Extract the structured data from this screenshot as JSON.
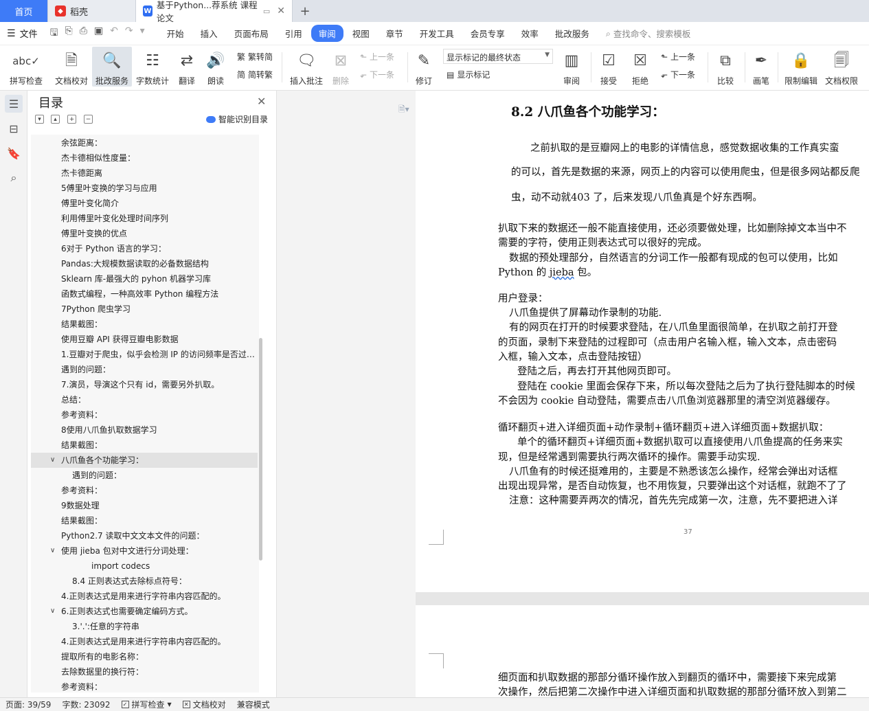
{
  "tabs": {
    "home": "首页",
    "daoke": "稻壳",
    "doc": "基于Python...荐系统 课程论文"
  },
  "menu": {
    "file": "文件",
    "tabs": [
      "开始",
      "插入",
      "页面布局",
      "引用",
      "审阅",
      "视图",
      "章节",
      "开发工具",
      "会员专享",
      "效率",
      "批改服务"
    ],
    "active_tab": "审阅",
    "search": "查找命令、搜索模板"
  },
  "ribbon": {
    "spell": "拼写检查",
    "proofread": "文档校对",
    "correction": "批改服务",
    "wordcount": "字数统计",
    "translate": "翻译",
    "read": "朗读",
    "trad": "繁转简",
    "simp": "简转繁",
    "insert_comment": "插入批注",
    "delete": "删除",
    "prev": "上一条",
    "next": "下一条",
    "revise": "修订",
    "markup_select": "显示标记的最终状态",
    "show_markup": "显示标记",
    "review": "审阅",
    "accept": "接受",
    "reject": "拒绝",
    "prev2": "上一条",
    "next2": "下一条",
    "compare": "比较",
    "pen": "画笔",
    "restrict": "限制编辑",
    "permission": "文档权限"
  },
  "toc": {
    "title": "目录",
    "ai_label": "智能识别目录",
    "items": [
      "余弦距离：",
      "杰卡德相似性度量：",
      "杰卡德距离",
      "5傅里叶变换的学习与应用",
      "傅里叶变化简介",
      "利用傅里叶变化处理时间序列",
      "傅里叶变换的优点",
      "6对于 Python 语言的学习：",
      "Pandas:大规模数据读取的必备数据结构",
      "Sklearn 库-最强大的 pyhon 机器学习库",
      "函数式编程，一种高效率 Python 编程方法",
      "7Python 爬虫学习",
      "结果截图：",
      "使用豆瓣 API 获得豆瓣电影数据",
      "1.豆瓣对于爬虫，似乎会检测 IP 的访问频率是否过于频繁",
      "遇到的问题：",
      "7.演员，导演这个只有 id，需要另外扒取。",
      "总结：",
      "参考资料：",
      "8使用八爪鱼扒取数据学习",
      "结果截图：",
      "八爪鱼各个功能学习：",
      "遇到的问题：",
      "参考资料：",
      "9数据处理",
      "结果截图：",
      "Python2.7 读取中文文本文件的问题：",
      "使用 jieba 包对中文进行分词处理：",
      "import codecs",
      "8.4 正则表达式去除标点符号：",
      "4.正则表达式是用来进行字符串内容匹配的。",
      "6.正则表达式也需要确定编码方式。",
      "3.'.':任意的字符串",
      "4.正则表达式是用来进行字符串内容匹配的。",
      "提取所有的电影名称：",
      "去除数据里的换行符：",
      "参考资料："
    ]
  },
  "page1": {
    "heading": "8.2  八爪鱼各个功能学习：",
    "p1a": "之前扒取的是豆瓣网上的电影的详情信息，感觉数据收集的工作真实蛮",
    "p1b": "的可以，首先是数据的来源，网页上的内容可以使用爬虫，但是很多网站都反爬",
    "p1c": "虫，动不动就403 了，后来发现八爪鱼真是个好东西啊。",
    "p2a": "扒取下来的数据还一般不能直接使用，还必须要做处理，比如删除掉文本当中不",
    "p2b": "需要的字符，使用正则表达式可以很好的完成。",
    "p3a": "数据的预处理部分，自然语言的分词工作一般都有现成的包可以使用，比如",
    "p3b_pre": "Python 的 ",
    "p3b_word": "jieba",
    "p3b_post": " 包。",
    "p4": "用户登录：",
    "p5": "八爪鱼提供了屏幕动作录制的功能.",
    "p6a": "有的网页在打开的时候要求登陆，在八爪鱼里面很简单，在扒取之前打开登",
    "p6b": "的页面，录制下来登陆的过程即可（点击用户名输入框，输入文本，点击密码",
    "p6c": "入框，输入文本，点击登陆按钮）",
    "p7": "登陆之后，再去打开其他网页即可。",
    "p8a": "登陆在 cookie 里面会保存下来，所以每次登陆之后为了执行登陆脚本的时候",
    "p8b": "不会因为 cookie 自动登陆，需要点击八爪鱼浏览器那里的清空浏览器缓存。",
    "p9": "循环翻页+进入详细页面+动作录制+循环翻页+进入详细页面+数据扒取：",
    "p10a": "单个的循环翻页+详细页面+数据扒取可以直接使用八爪鱼提高的任务来实",
    "p10b": "现，但是经常遇到需要执行两次循环的操作。需要手动实现.",
    "p11a": "八爪鱼有的时候还挺难用的，主要是不熟悉该怎么操作，经常会弹出对话框",
    "p11b": "出现出现异常，是否自动恢复，也不用恢复，只要弹出这个对话框，就跑不了了",
    "p12": "注意：这种需要弄两次的情况，首先先完成第一次，注意，先不要把进入详",
    "page_number": "37"
  },
  "page2": {
    "l1": "细页面和扒取数据的那部分循环操作放入到翻页的循环中，需要接下来完成第",
    "l2": "次操作，然后把第二次操作中进入详细页面和扒取数据的那部分循环放入到第二"
  },
  "status": {
    "page": "页面: 39/59",
    "words": "字数: 23092",
    "spell": "拼写检查",
    "proofread": "文档校对",
    "compat": "兼容模式"
  },
  "colors": {
    "accent": "#3e7bf7",
    "tabbar": "#dfe3ea",
    "selected_row": "#e2e2e2"
  }
}
